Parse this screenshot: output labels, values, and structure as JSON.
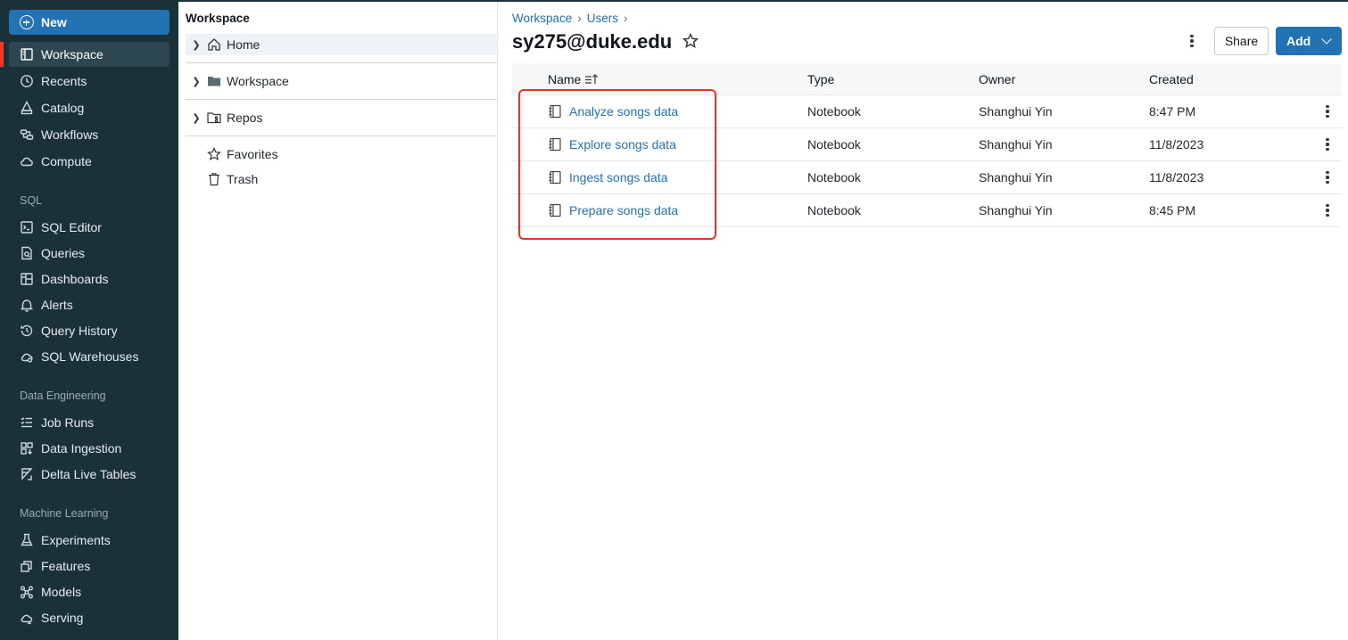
{
  "sidebar": {
    "new_label": "New",
    "items_top": [
      {
        "label": "Workspace",
        "icon": "workspace-icon",
        "active": true
      },
      {
        "label": "Recents",
        "icon": "clock-icon"
      },
      {
        "label": "Catalog",
        "icon": "catalog-icon"
      },
      {
        "label": "Workflows",
        "icon": "workflows-icon"
      },
      {
        "label": "Compute",
        "icon": "cloud-icon"
      }
    ],
    "sql_heading": "SQL",
    "items_sql": [
      {
        "label": "SQL Editor",
        "icon": "sql-editor-icon"
      },
      {
        "label": "Queries",
        "icon": "queries-icon"
      },
      {
        "label": "Dashboards",
        "icon": "dashboards-icon"
      },
      {
        "label": "Alerts",
        "icon": "bell-icon"
      },
      {
        "label": "Query History",
        "icon": "history-icon"
      },
      {
        "label": "SQL Warehouses",
        "icon": "warehouse-icon"
      }
    ],
    "de_heading": "Data Engineering",
    "items_de": [
      {
        "label": "Job Runs",
        "icon": "job-runs-icon"
      },
      {
        "label": "Data Ingestion",
        "icon": "ingestion-icon"
      },
      {
        "label": "Delta Live Tables",
        "icon": "delta-icon"
      }
    ],
    "ml_heading": "Machine Learning",
    "items_ml": [
      {
        "label": "Experiments",
        "icon": "flask-icon"
      },
      {
        "label": "Features",
        "icon": "features-icon"
      },
      {
        "label": "Models",
        "icon": "models-icon"
      },
      {
        "label": "Serving",
        "icon": "serving-icon"
      }
    ]
  },
  "tree": {
    "title": "Workspace",
    "items": [
      {
        "label": "Home",
        "icon": "home-icon"
      },
      {
        "label": "Workspace",
        "icon": "folder-icon"
      },
      {
        "label": "Repos",
        "icon": "repos-icon"
      },
      {
        "label": "Favorites",
        "icon": "star-icon"
      },
      {
        "label": "Trash",
        "icon": "trash-icon"
      }
    ]
  },
  "breadcrumb": [
    "Workspace",
    "Users"
  ],
  "page": {
    "title": "sy275@duke.edu",
    "share_label": "Share",
    "add_label": "Add"
  },
  "table": {
    "headers": {
      "name": "Name",
      "type": "Type",
      "owner": "Owner",
      "created": "Created"
    },
    "rows": [
      {
        "name": "Analyze songs data",
        "type": "Notebook",
        "owner": "Shanghui Yin",
        "created": "8:47 PM"
      },
      {
        "name": "Explore songs data",
        "type": "Notebook",
        "owner": "Shanghui Yin",
        "created": "11/8/2023"
      },
      {
        "name": "Ingest songs data",
        "type": "Notebook",
        "owner": "Shanghui Yin",
        "created": "11/8/2023"
      },
      {
        "name": "Prepare songs data",
        "type": "Notebook",
        "owner": "Shanghui Yin",
        "created": "8:45 PM"
      }
    ]
  },
  "colors": {
    "sidebar_bg": "#1b3139",
    "accent_blue": "#2272b4",
    "active_marker": "#ff3621",
    "highlight_box": "#e53527"
  }
}
